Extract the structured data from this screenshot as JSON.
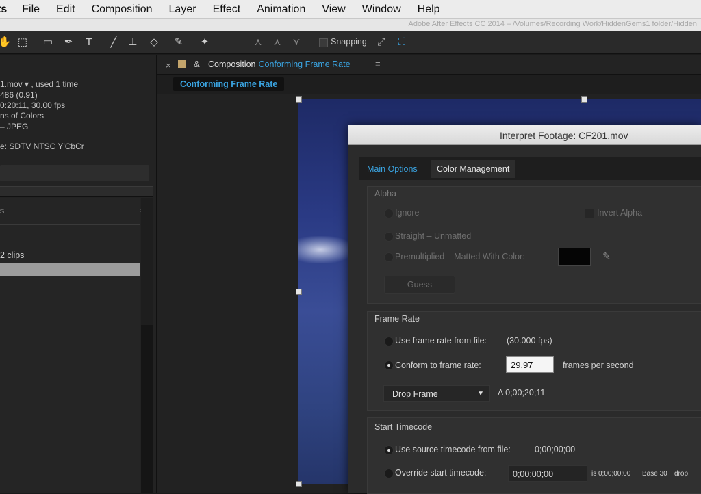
{
  "menubar": {
    "app_label": "ts",
    "items": [
      "File",
      "Edit",
      "Composition",
      "Layer",
      "Effect",
      "Animation",
      "View",
      "Window",
      "Help"
    ]
  },
  "window_title": "Adobe After Effects CC 2014 – /Volumes/Recording Work/HiddenGems1 folder/Hidden",
  "toolbar": {
    "tools": [
      "hand-icon",
      "marquee-icon",
      "rectangle-icon",
      "pen-icon",
      "type-icon",
      "brush-icon",
      "clone-stamp-icon",
      "eraser-icon",
      "roto-brush-icon",
      "puppet-pin-icon",
      "axis-icon-1",
      "axis-icon-2",
      "axis-icon-3"
    ],
    "snapping_label": "Snapping"
  },
  "project_panel": {
    "info_lines": [
      "1.mov ▾ , used 1 time",
      "486 (0.91)",
      "0:20:11, 30.00 fps",
      "ns of Colors",
      "– JPEG",
      "e: SDTV NTSC Y'CbCr"
    ],
    "column_header": "s",
    "clips_label": "2 clips"
  },
  "composition_panel": {
    "tab_prefix": "Composition",
    "comp_name": "Conforming Frame Rate",
    "subtab": "Conforming Frame Rate"
  },
  "dialog": {
    "title": "Interpret Footage: CF201.mov",
    "tabs": [
      "Main Options",
      "Color Management"
    ],
    "alpha": {
      "header": "Alpha",
      "ignore": "Ignore",
      "invert": "Invert Alpha",
      "straight": "Straight – Unmatted",
      "premult": "Premultiplied – Matted With Color:",
      "guess": "Guess"
    },
    "frame_rate": {
      "header": "Frame Rate",
      "use_file": "Use frame rate from file:",
      "file_fps": "(30.000 fps)",
      "conform": "Conform to frame rate:",
      "value": "29.97",
      "unit": "frames per second",
      "drop_mode": "Drop Frame",
      "duration": "Δ 0;00;20;11"
    },
    "start_timecode": {
      "header": "Start Timecode",
      "use_source": "Use source timecode from file:",
      "source_tc": "0;00;00;00",
      "override": "Override start timecode:",
      "override_tc": "0;00;00;00",
      "is_value": "is 0;00;00;00",
      "base": "Base 30",
      "drop": "drop"
    }
  }
}
